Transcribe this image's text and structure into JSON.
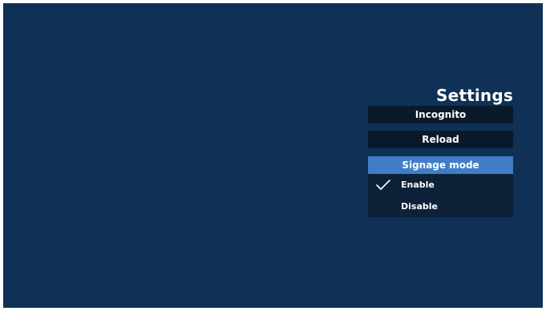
{
  "settings": {
    "title": "Settings",
    "incognito_label": "Incognito",
    "reload_label": "Reload",
    "signage_mode": {
      "label": "Signage mode",
      "options": [
        {
          "label": "Enable",
          "selected": true
        },
        {
          "label": "Disable",
          "selected": false
        }
      ]
    }
  },
  "colors": {
    "background": "#0f3155",
    "button": "#0b1a2b",
    "highlight": "#3f7ec7",
    "dropdown": "#0d2239"
  }
}
